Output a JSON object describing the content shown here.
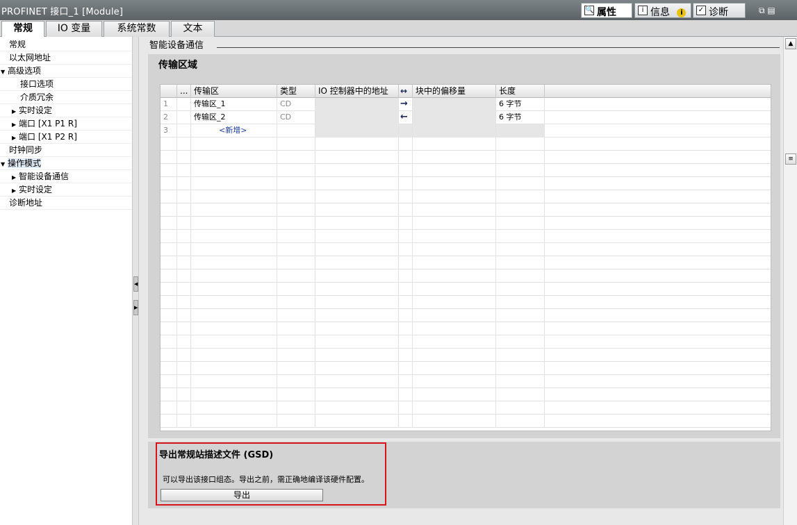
{
  "window": {
    "title": "PROFINET 接口_1 [Module]"
  },
  "inspector_tabs": [
    {
      "label": "属性",
      "icon": "properties-icon"
    },
    {
      "label": "信息",
      "icon": "info-icon"
    },
    {
      "label": "诊断",
      "icon": "diagnostics-icon"
    }
  ],
  "info_badge": "i",
  "window_buttons": "⧉ ▤",
  "tabs": [
    "常规",
    "IO 变量",
    "系统常数",
    "文本"
  ],
  "sidebar": {
    "items": [
      {
        "label": "常规"
      },
      {
        "label": "以太网地址"
      },
      {
        "label": "高级选项",
        "expander": "▼"
      },
      {
        "label": "接口选项"
      },
      {
        "label": "介质冗余"
      },
      {
        "label": "实时设定",
        "expander": "▶"
      },
      {
        "label": "端口 [X1 P1 R]",
        "expander": "▶"
      },
      {
        "label": "端口 [X1 P2 R]",
        "expander": "▶"
      },
      {
        "label": "时钟同步"
      },
      {
        "label": "操作模式",
        "expander": "▼"
      },
      {
        "label": "智能设备通信",
        "expander": "▶"
      },
      {
        "label": "实时设定",
        "expander": "▶"
      },
      {
        "label": "诊断地址"
      }
    ]
  },
  "section": {
    "title": "智能设备通信",
    "transfer_area": {
      "heading": "传输区域",
      "columns": [
        "...",
        "传输区",
        "类型",
        "IO 控制器中的地址",
        "↔",
        "块中的偏移量",
        "长度"
      ],
      "rows": [
        {
          "num": "1",
          "name": "传输区_1",
          "type": "CD",
          "io_addr": "",
          "direction": "→",
          "offset": "",
          "length": "6 字节"
        },
        {
          "num": "2",
          "name": "传输区_2",
          "type": "CD",
          "io_addr": "",
          "direction": "←",
          "offset": "",
          "length": "6 字节"
        },
        {
          "num": "3",
          "name": "<新增>",
          "type": "",
          "io_addr": "",
          "direction": "",
          "offset": "",
          "length": ""
        }
      ]
    }
  },
  "gsd": {
    "heading": "导出常规站描述文件 (GSD)",
    "description": "可以导出该接口组态。导出之前，需正确地编译该硬件配置。",
    "export_label": "导出"
  },
  "scrollbar": {
    "up": "▲",
    "grip": "≡"
  },
  "splitter": {
    "collapse": "◀",
    "expand": "▶"
  }
}
